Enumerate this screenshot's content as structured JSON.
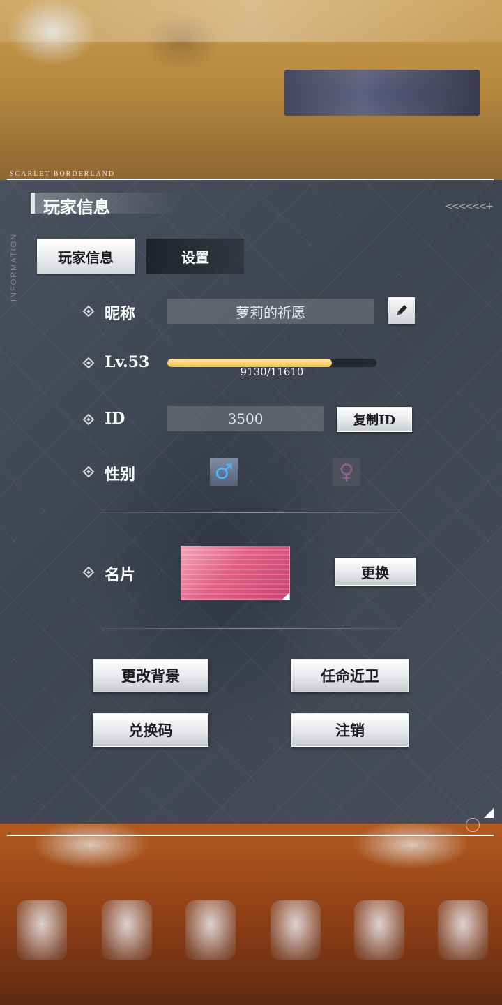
{
  "background": {
    "brand_text": "SCARLET BORDERLAND"
  },
  "panel": {
    "header_title": "玩家信息",
    "side_text": "INFORMATION",
    "chevrons": "<<<<<<+"
  },
  "tabs": [
    {
      "label": "玩家信息",
      "active": true
    },
    {
      "label": "设置",
      "active": false
    }
  ],
  "profile": {
    "nickname_label": "昵称",
    "nickname_value": "萝莉的祈愿",
    "level_label": "Lv.53",
    "xp_current": 9130,
    "xp_max": 11610,
    "xp_text": "9130/11610",
    "id_label": "ID",
    "id_value": "3500",
    "copy_id_label": "复制ID",
    "gender_label": "性别",
    "gender_selected": "male",
    "card_label": "名片",
    "card_change_label": "更换"
  },
  "actions": {
    "change_background": "更改背景",
    "appoint_guard": "任命近卫",
    "redeem_code": "兑换码",
    "logout": "注销"
  },
  "colors": {
    "xp_fill": "#f2bf4a",
    "male_icon": "#4fb4ff",
    "female_icon": "#c86ebe",
    "card_pink": "#e25f86"
  },
  "icons": {
    "edit": "pencil-icon",
    "male": "male-symbol-icon",
    "female": "female-symbol-icon"
  }
}
